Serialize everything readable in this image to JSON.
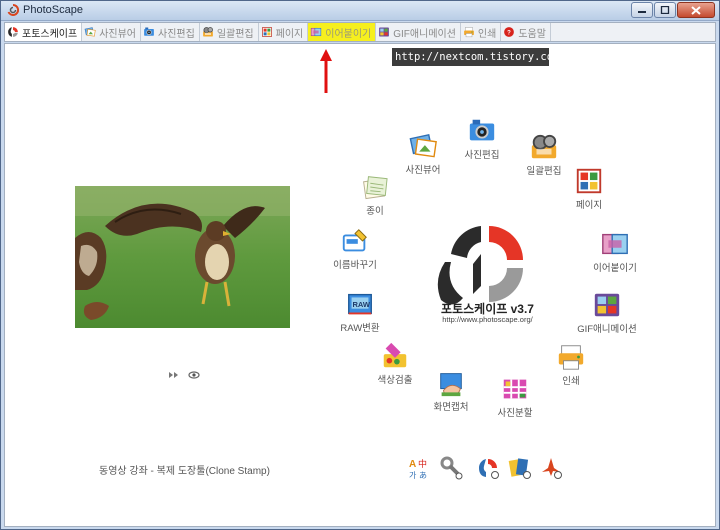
{
  "window": {
    "title": "PhotoScape"
  },
  "tabs": [
    {
      "id": "home",
      "label": "포토스케이프",
      "state": "active",
      "icon": "photoscape-icon",
      "color": "#d9451e"
    },
    {
      "id": "viewer",
      "label": "사진뷰어",
      "state": "normal",
      "icon": "viewer-icon",
      "color": "#3a7bd5"
    },
    {
      "id": "editor",
      "label": "사진편집",
      "state": "normal",
      "icon": "editor-icon",
      "color": "#2f6fb4"
    },
    {
      "id": "batch",
      "label": "일괄편집",
      "state": "normal",
      "icon": "batch-icon",
      "color": "#e0a12b"
    },
    {
      "id": "page",
      "label": "페이지",
      "state": "normal",
      "icon": "page-icon",
      "color": "#c0392b"
    },
    {
      "id": "combine",
      "label": "이어붙이기",
      "state": "highlighted",
      "icon": "combine-icon",
      "color": "#c46a2b"
    },
    {
      "id": "gif",
      "label": "GIF애니메이션",
      "state": "normal",
      "icon": "gif-icon",
      "color": "#7b5aa6"
    },
    {
      "id": "print",
      "label": "인쇄",
      "state": "normal",
      "icon": "print-icon",
      "color": "#d96a2b"
    },
    {
      "id": "help",
      "label": "도움말",
      "state": "normal",
      "icon": "help-icon",
      "color": "#d7231c"
    }
  ],
  "watermark": {
    "text": "http://nextcom.tistory.com"
  },
  "menu_items": [
    {
      "id": "viewer",
      "label": "사진뷰어",
      "icon": "viewer-icon"
    },
    {
      "id": "editor",
      "label": "사진편집",
      "icon": "editor-icon"
    },
    {
      "id": "batch",
      "label": "일괄편집",
      "icon": "batch-icon"
    },
    {
      "id": "paper",
      "label": "종이",
      "icon": "paper-icon"
    },
    {
      "id": "page",
      "label": "페이지",
      "icon": "page-icon"
    },
    {
      "id": "rename",
      "label": "이름바꾸기",
      "icon": "rename-icon"
    },
    {
      "id": "combine",
      "label": "이어붙이기",
      "icon": "combine-icon"
    },
    {
      "id": "raw",
      "label": "RAW변환",
      "icon": "raw-icon"
    },
    {
      "id": "gif",
      "label": "GIF애니메이션",
      "icon": "gif-icon"
    },
    {
      "id": "color",
      "label": "색상검출",
      "icon": "color-picker-icon"
    },
    {
      "id": "print",
      "label": "인쇄",
      "icon": "print-icon"
    },
    {
      "id": "capture",
      "label": "화면캡처",
      "icon": "screen-capture-icon"
    },
    {
      "id": "split",
      "label": "사진분할",
      "icon": "split-icon"
    }
  ],
  "center": {
    "name": "포토스케이프 v3.7",
    "url": "http://www.photoscape.org/"
  },
  "bottom_link": {
    "text": "동영상 강좌 - 복제 도장툴(Clone Stamp)"
  },
  "colors": {
    "accent": "#e53526",
    "highlight": "#f6ef1e",
    "logo_gray": "#9a9a9a",
    "logo_dark": "#2b2b2b"
  }
}
